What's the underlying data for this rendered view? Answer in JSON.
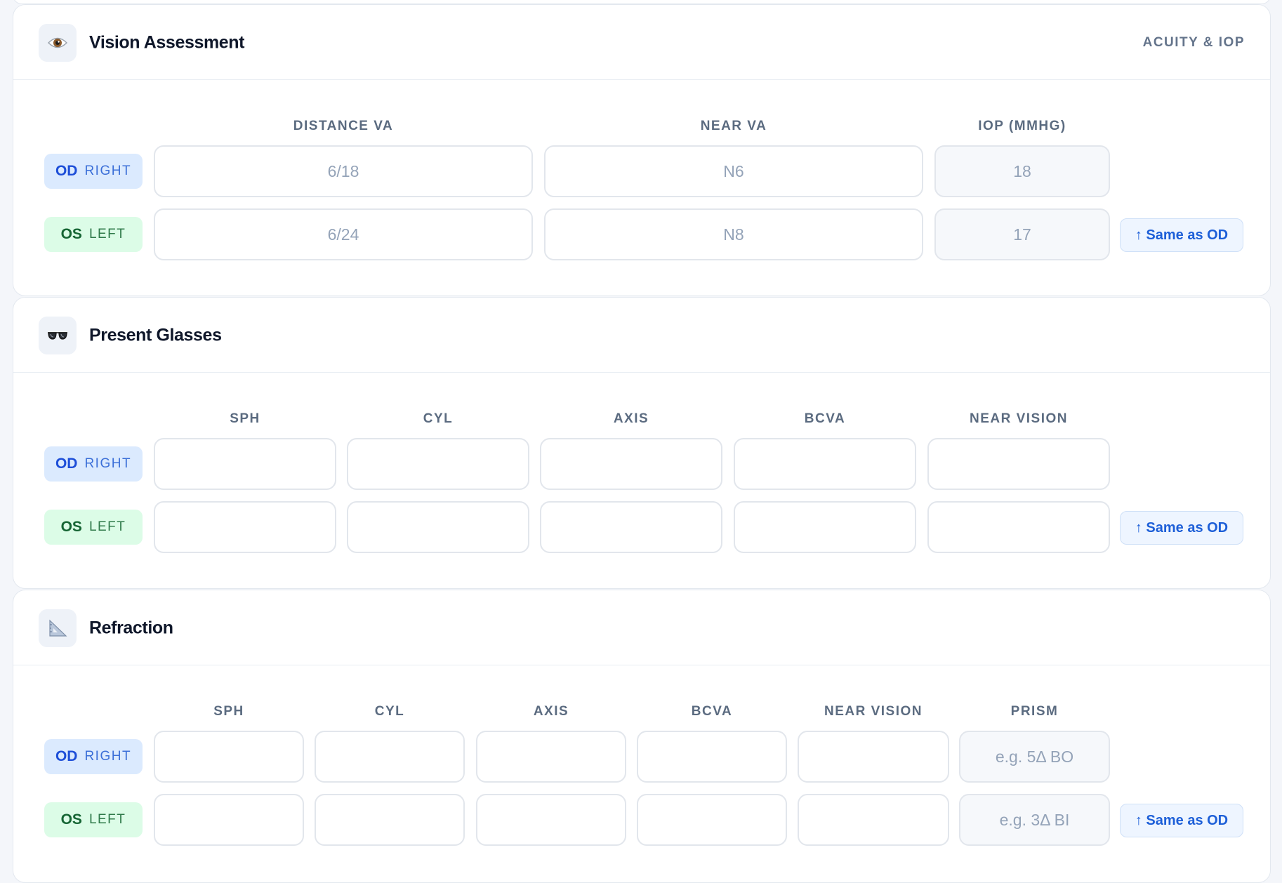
{
  "vision": {
    "title": "Vision Assessment",
    "tag": "ACUITY & IOP",
    "icon": "eye-icon",
    "columns": [
      "DISTANCE VA",
      "NEAR VA",
      "IOP (MMHG)"
    ],
    "od": {
      "code": "OD",
      "side": "RIGHT",
      "values": [
        "6/18",
        "N6",
        "18"
      ]
    },
    "os": {
      "code": "OS",
      "side": "LEFT",
      "values": [
        "6/24",
        "N8",
        "17"
      ]
    },
    "same_label": "↑ Same as OD"
  },
  "glasses": {
    "title": "Present Glasses",
    "icon": "glasses-icon",
    "columns": [
      "SPH",
      "CYL",
      "AXIS",
      "BCVA",
      "NEAR VISION"
    ],
    "od": {
      "code": "OD",
      "side": "RIGHT",
      "values": [
        "",
        "",
        "",
        "",
        ""
      ]
    },
    "os": {
      "code": "OS",
      "side": "LEFT",
      "values": [
        "",
        "",
        "",
        "",
        ""
      ]
    },
    "same_label": "↑ Same as OD"
  },
  "refraction": {
    "title": "Refraction",
    "icon": "triangle-ruler-icon",
    "columns": [
      "SPH",
      "CYL",
      "AXIS",
      "BCVA",
      "NEAR VISION",
      "PRISM"
    ],
    "od": {
      "code": "OD",
      "side": "RIGHT",
      "values": [
        "",
        "",
        "",
        "",
        "",
        "e.g. 5Δ BO"
      ]
    },
    "os": {
      "code": "OS",
      "side": "LEFT",
      "values": [
        "",
        "",
        "",
        "",
        "",
        "e.g. 3Δ BI"
      ]
    },
    "same_label": "↑ Same as OD"
  },
  "colors": {
    "od_badge": "#dbeafe",
    "os_badge": "#dcfce7",
    "accent": "#1d5fd8"
  }
}
